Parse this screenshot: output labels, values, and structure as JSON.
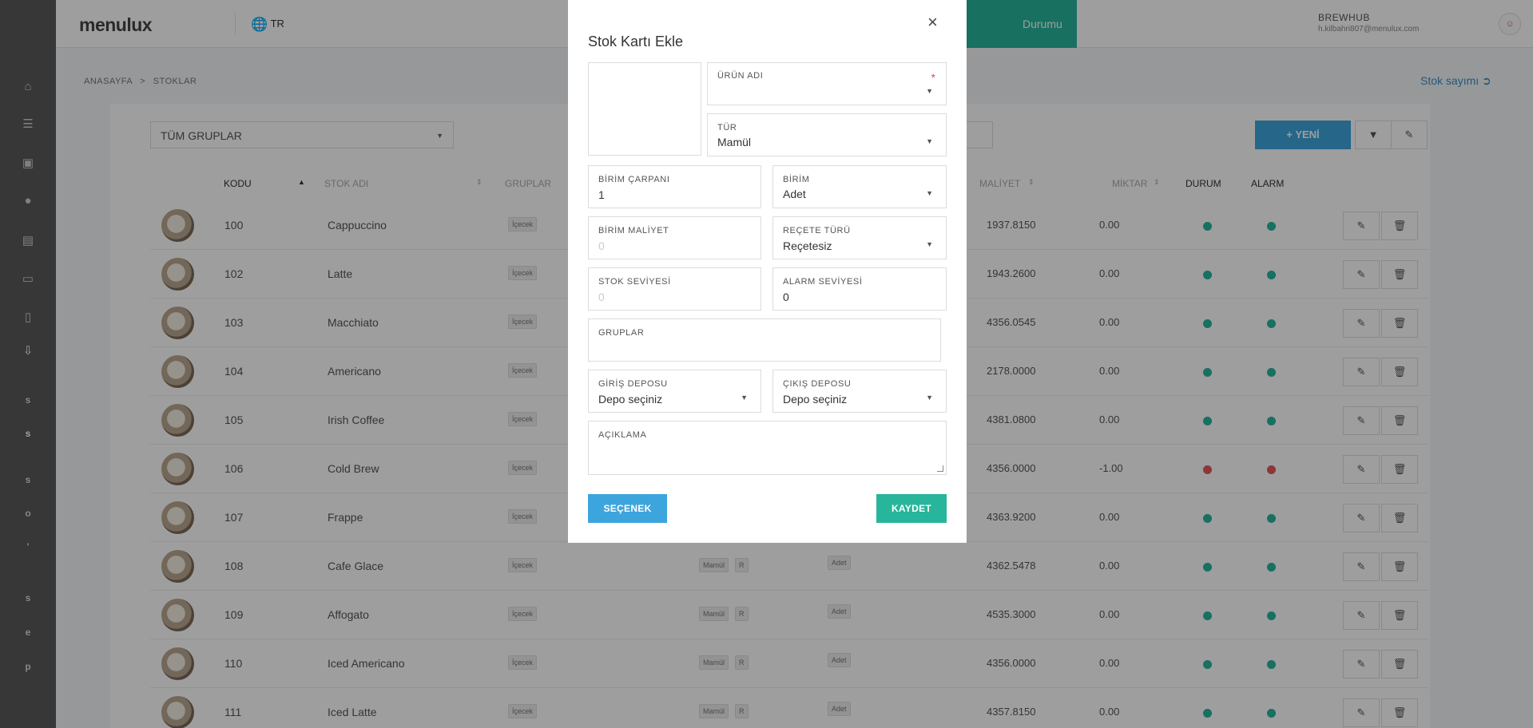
{
  "header": {
    "logo": "menulux",
    "language": "TR",
    "status_tab": "Durumu",
    "brand": "BREWHUB",
    "email": "h.kilbahri807@menulux.com",
    "notification_count": "0"
  },
  "sidebar": {
    "letters": [
      "s",
      "s",
      "s",
      "o",
      "'",
      "s",
      "e",
      "p"
    ]
  },
  "breadcrumb": {
    "home": "ANASAYFA",
    "separator": ">",
    "current": "STOKLAR"
  },
  "stock_count_link": "Stok sayımı",
  "toolbar": {
    "group_select": "TÜM GRUPLAR",
    "new_button": "+ YENİ"
  },
  "table": {
    "headers": {
      "code": "KODU",
      "name": "STOK ADI",
      "groups": "GRUPLAR",
      "cost": "MALİYET",
      "quantity": "MİKTAR",
      "status": "DURUM",
      "alarm": "ALARM"
    },
    "rows": [
      {
        "code": "100",
        "name": "Cappuccino",
        "group": "İçecek",
        "type": "",
        "r": "",
        "unit": "",
        "cost": "1937.8150",
        "qty": "0.00",
        "status": "green",
        "alarm": "green"
      },
      {
        "code": "102",
        "name": "Latte",
        "group": "İçecek",
        "type": "",
        "r": "",
        "unit": "",
        "cost": "1943.2600",
        "qty": "0.00",
        "status": "green",
        "alarm": "green"
      },
      {
        "code": "103",
        "name": "Macchiato",
        "group": "İçecek",
        "type": "",
        "r": "",
        "unit": "",
        "cost": "4356.0545",
        "qty": "0.00",
        "status": "green",
        "alarm": "green"
      },
      {
        "code": "104",
        "name": "Americano",
        "group": "İçecek",
        "type": "",
        "r": "",
        "unit": "",
        "cost": "2178.0000",
        "qty": "0.00",
        "status": "green",
        "alarm": "green"
      },
      {
        "code": "105",
        "name": "Irish Coffee",
        "group": "İçecek",
        "type": "",
        "r": "",
        "unit": "",
        "cost": "4381.0800",
        "qty": "0.00",
        "status": "green",
        "alarm": "green"
      },
      {
        "code": "106",
        "name": "Cold Brew",
        "group": "İçecek",
        "type": "",
        "r": "",
        "unit": "",
        "cost": "4356.0000",
        "qty": "-1.00",
        "status": "red",
        "alarm": "red"
      },
      {
        "code": "107",
        "name": "Frappe",
        "group": "İçecek",
        "type": "",
        "r": "",
        "unit": "",
        "cost": "4363.9200",
        "qty": "0.00",
        "status": "green",
        "alarm": "green"
      },
      {
        "code": "108",
        "name": "Cafe Glace",
        "group": "İçecek",
        "type": "Mamül",
        "r": "R",
        "unit": "Adet",
        "cost": "4362.5478",
        "qty": "0.00",
        "status": "green",
        "alarm": "green"
      },
      {
        "code": "109",
        "name": "Affogato",
        "group": "İçecek",
        "type": "Mamül",
        "r": "R",
        "unit": "Adet",
        "cost": "4535.3000",
        "qty": "0.00",
        "status": "green",
        "alarm": "green"
      },
      {
        "code": "110",
        "name": "Iced Americano",
        "group": "İçecek",
        "type": "Mamül",
        "r": "R",
        "unit": "Adet",
        "cost": "4356.0000",
        "qty": "0.00",
        "status": "green",
        "alarm": "green"
      },
      {
        "code": "111",
        "name": "Iced Latte",
        "group": "İçecek",
        "type": "Mamül",
        "r": "R",
        "unit": "Adet",
        "cost": "4357.8150",
        "qty": "0.00",
        "status": "green",
        "alarm": "green"
      }
    ]
  },
  "modal": {
    "title": "Stok Kartı Ekle",
    "close": "×",
    "product_name": {
      "label": "ÜRÜN ADI",
      "value": "",
      "required": "*"
    },
    "type": {
      "label": "TÜR",
      "value": "Mamül"
    },
    "unit_multiplier": {
      "label": "BİRİM ÇARPANI",
      "value": "1"
    },
    "unit": {
      "label": "BİRİM",
      "value": "Adet"
    },
    "unit_cost": {
      "label": "BİRİM MALİYET",
      "placeholder": "0"
    },
    "recipe_type": {
      "label": "REÇETE TÜRÜ",
      "value": "Reçetesiz"
    },
    "stock_level": {
      "label": "STOK SEVİYESİ",
      "placeholder": "0"
    },
    "alarm_level": {
      "label": "ALARM SEVİYESİ",
      "value": "0"
    },
    "groups": {
      "label": "GRUPLAR",
      "value": ""
    },
    "entry_warehouse": {
      "label": "GİRİŞ DEPOSU",
      "value": "Depo seçiniz"
    },
    "exit_warehouse": {
      "label": "ÇIKIŞ DEPOSU",
      "value": "Depo seçiniz"
    },
    "description": {
      "label": "AÇIKLAMA",
      "value": ""
    },
    "option_button": "SEÇENEK",
    "save_button": "KAYDET"
  },
  "colors": {
    "accent_green": "#27b59b",
    "accent_blue": "#3da5dd",
    "status_red": "#e25a5a",
    "sidebar": "#5a5a5a"
  }
}
